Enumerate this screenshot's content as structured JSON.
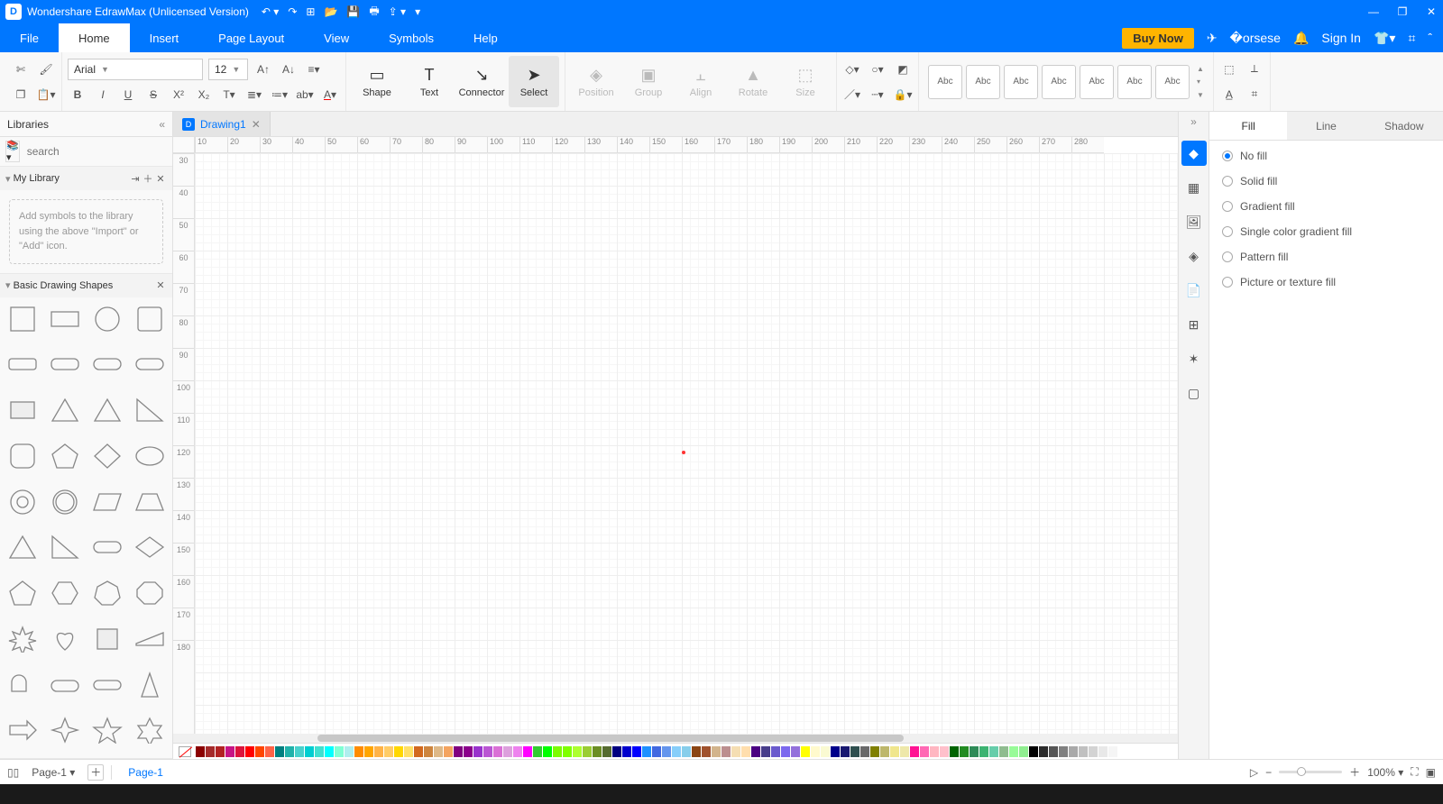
{
  "app": {
    "title": "Wondershare EdrawMax (Unlicensed Version)"
  },
  "menubar": {
    "items": [
      "File",
      "Home",
      "Insert",
      "Page Layout",
      "View",
      "Symbols",
      "Help"
    ],
    "active": "Home",
    "buy": "Buy Now",
    "signin": "Sign In"
  },
  "ribbon": {
    "font": "Arial",
    "size": "12",
    "bigbtns": {
      "shape": "Shape",
      "text": "Text",
      "connector": "Connector",
      "select": "Select",
      "position": "Position",
      "group": "Group",
      "align": "Align",
      "rotate": "Rotate",
      "sizeb": "Size"
    },
    "style_label": "Abc"
  },
  "left": {
    "title": "Libraries",
    "search_placeholder": "search",
    "mylib": "My Library",
    "placeholder": "Add symbols to the library using the above \"Import\" or \"Add\" icon.",
    "basic": "Basic Drawing Shapes"
  },
  "doc": {
    "tab": "Drawing1"
  },
  "ruler_h": [
    "10",
    "20",
    "30",
    "40",
    "50",
    "60",
    "70",
    "80",
    "90",
    "100",
    "110",
    "120",
    "130",
    "140",
    "150",
    "160",
    "170",
    "180",
    "190",
    "200",
    "210",
    "220",
    "230",
    "240",
    "250",
    "260",
    "270",
    "280"
  ],
  "ruler_v": [
    "30",
    "40",
    "50",
    "60",
    "70",
    "80",
    "90",
    "100",
    "110",
    "120",
    "130",
    "140",
    "150",
    "160",
    "170",
    "180"
  ],
  "rightpanel": {
    "tabs": [
      "Fill",
      "Line",
      "Shadow"
    ],
    "active": "Fill",
    "fill_options": [
      "No fill",
      "Solid fill",
      "Gradient fill",
      "Single color gradient fill",
      "Pattern fill",
      "Picture or texture fill"
    ],
    "selected": "No fill"
  },
  "status": {
    "page_sel": "Page-1",
    "page_tab": "Page-1",
    "zoom": "100%"
  },
  "colors": [
    "#8b0000",
    "#a52a2a",
    "#b22222",
    "#c71585",
    "#dc143c",
    "#ff0000",
    "#ff4500",
    "#ff6347",
    "#008080",
    "#20b2aa",
    "#48d1cc",
    "#00ced1",
    "#40e0d0",
    "#00ffff",
    "#7fffd4",
    "#afeeee",
    "#ff8c00",
    "#ffa500",
    "#ffb347",
    "#ffcc66",
    "#ffd700",
    "#ffe066",
    "#d2691e",
    "#cd853f",
    "#deb887",
    "#f4a460",
    "#800080",
    "#8b008b",
    "#9932cc",
    "#ba55d3",
    "#da70d6",
    "#dda0dd",
    "#ee82ee",
    "#ff00ff",
    "#32cd32",
    "#00ff00",
    "#7cfc00",
    "#7fff00",
    "#adff2f",
    "#9acd32",
    "#6b8e23",
    "#556b2f",
    "#000080",
    "#0000cd",
    "#0000ff",
    "#1e90ff",
    "#4169e1",
    "#6495ed",
    "#87cefa",
    "#87ceeb",
    "#8b4513",
    "#a0522d",
    "#d2b48c",
    "#bc8f8f",
    "#f5deb3",
    "#ffdead",
    "#4b0082",
    "#483d8b",
    "#6a5acd",
    "#7b68ee",
    "#9370db",
    "#ffff00",
    "#fffacd",
    "#fafad2",
    "#00008b",
    "#191970",
    "#2f4f4f",
    "#696969",
    "#808000",
    "#bdb76b",
    "#f0e68c",
    "#eee8aa",
    "#ff1493",
    "#ff69b4",
    "#ffb6c1",
    "#ffc0cb",
    "#006400",
    "#228b22",
    "#2e8b57",
    "#3cb371",
    "#66cdaa",
    "#8fbc8f",
    "#98fb98",
    "#90ee90",
    "#000000",
    "#2b2b2b",
    "#555555",
    "#808080",
    "#a9a9a9",
    "#c0c0c0",
    "#d3d3d3",
    "#e8e8e8",
    "#f5f5f5",
    "#ffffff"
  ]
}
